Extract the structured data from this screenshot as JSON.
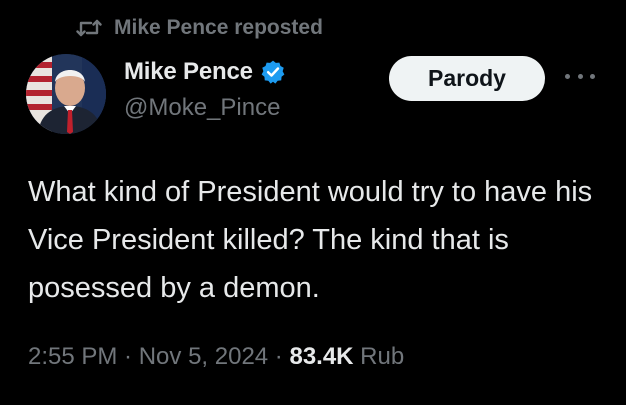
{
  "repost": {
    "text": "Mike Pence reposted",
    "icon": "repost-icon"
  },
  "author": {
    "display_name": "Mike Pence",
    "handle": "@Moke_Pince",
    "verified_icon": "verified-badge-icon",
    "verified_color": "#1d9bf0"
  },
  "label_button": "Parody",
  "more_icon": "more-icon",
  "tweet": {
    "text": "What kind of President would try to have his Vice President killed? The kind that is posessed by a demon."
  },
  "meta": {
    "time": "2:55 PM",
    "separator1": " · ",
    "date": "Nov 5, 2024",
    "separator2": " · ",
    "views": "83.4K",
    "views_suffix": " Rub"
  },
  "colors": {
    "background": "#000000",
    "text": "#e7e9ea",
    "muted": "#71767b",
    "accent": "#1d9bf0"
  }
}
